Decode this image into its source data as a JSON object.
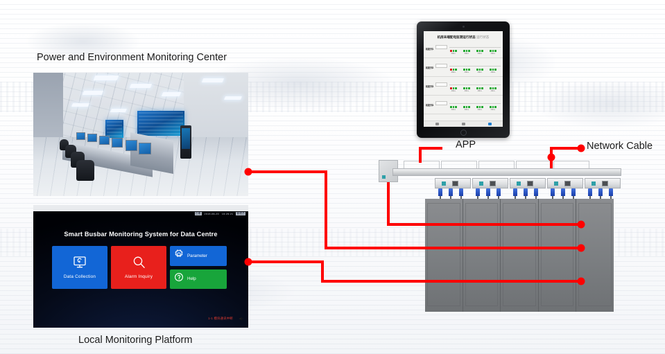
{
  "diagram": {
    "title_power_env": "Power and Environment Monitoring Center",
    "label_app": "APP",
    "label_network_cable": "Network Cable",
    "label_local_platform": "Local Monitoring Platform"
  },
  "colors": {
    "wire_red": "#ff0000",
    "tile_blue": "#1266d6",
    "tile_red": "#e8201c",
    "tile_green": "#18a53b",
    "led_green": "#1faa2e",
    "led_red": "#d81f1f",
    "indicator_teal": "#2fa0a8",
    "plug_blue": "#1b3fa8",
    "cabinet_gray": "#7b7e81"
  },
  "local_platform": {
    "heading": "Smart Busbar Monitoring System for Data Centre",
    "status_date": "2019-06-20",
    "status_time": "15:25:21",
    "footer_note": "1-1 模块通讯中断",
    "speaker_icon": "speaker-icon",
    "tiles": [
      {
        "label": "Data Collection",
        "icon": "monitor-icon",
        "color": "#1266d6"
      },
      {
        "label": "Alarm Inquiry",
        "icon": "magnifier-icon",
        "color": "#e8201c"
      },
      {
        "label": "Parameter",
        "icon": "gear-icon",
        "color": "#1266d6"
      },
      {
        "label": "Help",
        "icon": "question-icon",
        "color": "#18a53b"
      }
    ]
  },
  "tablet_app": {
    "title": "机房末端配电监测运行状态",
    "rows": [
      {
        "name": "机柜列1",
        "box": "",
        "groups": [
          {
            "leds": [
              "r",
              "g",
              "g"
            ],
            "caption": "机柜01"
          },
          {
            "leds": [
              "g",
              "g",
              "g"
            ],
            "caption": "机柜02"
          },
          {
            "leds": [
              "g",
              "g",
              "g"
            ],
            "caption": "机柜03"
          },
          {
            "leds": [
              "g",
              "g",
              "g"
            ],
            "caption": "机柜04"
          }
        ]
      },
      {
        "name": "机柜列2",
        "box": "",
        "groups": [
          {
            "leds": [
              "r",
              "g",
              "g"
            ],
            "caption": "机柜05"
          },
          {
            "leds": [
              "g",
              "g",
              "g"
            ],
            "caption": "机柜06"
          },
          {
            "leds": [
              "g",
              "g",
              "g"
            ],
            "caption": "机柜07"
          },
          {
            "leds": [
              "g",
              "g",
              "g"
            ],
            "caption": "机柜08"
          }
        ]
      },
      {
        "name": "机柜列3",
        "box": "",
        "groups": [
          {
            "leds": [
              "r",
              "g",
              "g"
            ],
            "caption": "机柜09"
          },
          {
            "leds": [
              "g",
              "g",
              "g"
            ],
            "caption": "机柜10"
          },
          {
            "leds": [
              "g",
              "g",
              "g"
            ],
            "caption": "机柜11"
          },
          {
            "leds": [
              "g",
              "g",
              "g"
            ],
            "caption": "机柜12"
          }
        ]
      },
      {
        "name": "机柜列4",
        "box": "",
        "groups": [
          {
            "leds": [
              "g",
              "g",
              "g"
            ],
            "caption": "机柜13"
          },
          {
            "leds": [
              "g",
              "g",
              "g"
            ],
            "caption": "机柜14"
          },
          {
            "leds": [
              "g",
              "g",
              "g"
            ],
            "caption": "机柜15"
          },
          {
            "leds": [
              "g",
              "g",
              "g"
            ],
            "caption": "机柜16"
          }
        ]
      }
    ]
  },
  "busbar": {
    "tapoff_count": 5,
    "plugs_per_tapoff": 3,
    "cabinet_count": 5
  }
}
